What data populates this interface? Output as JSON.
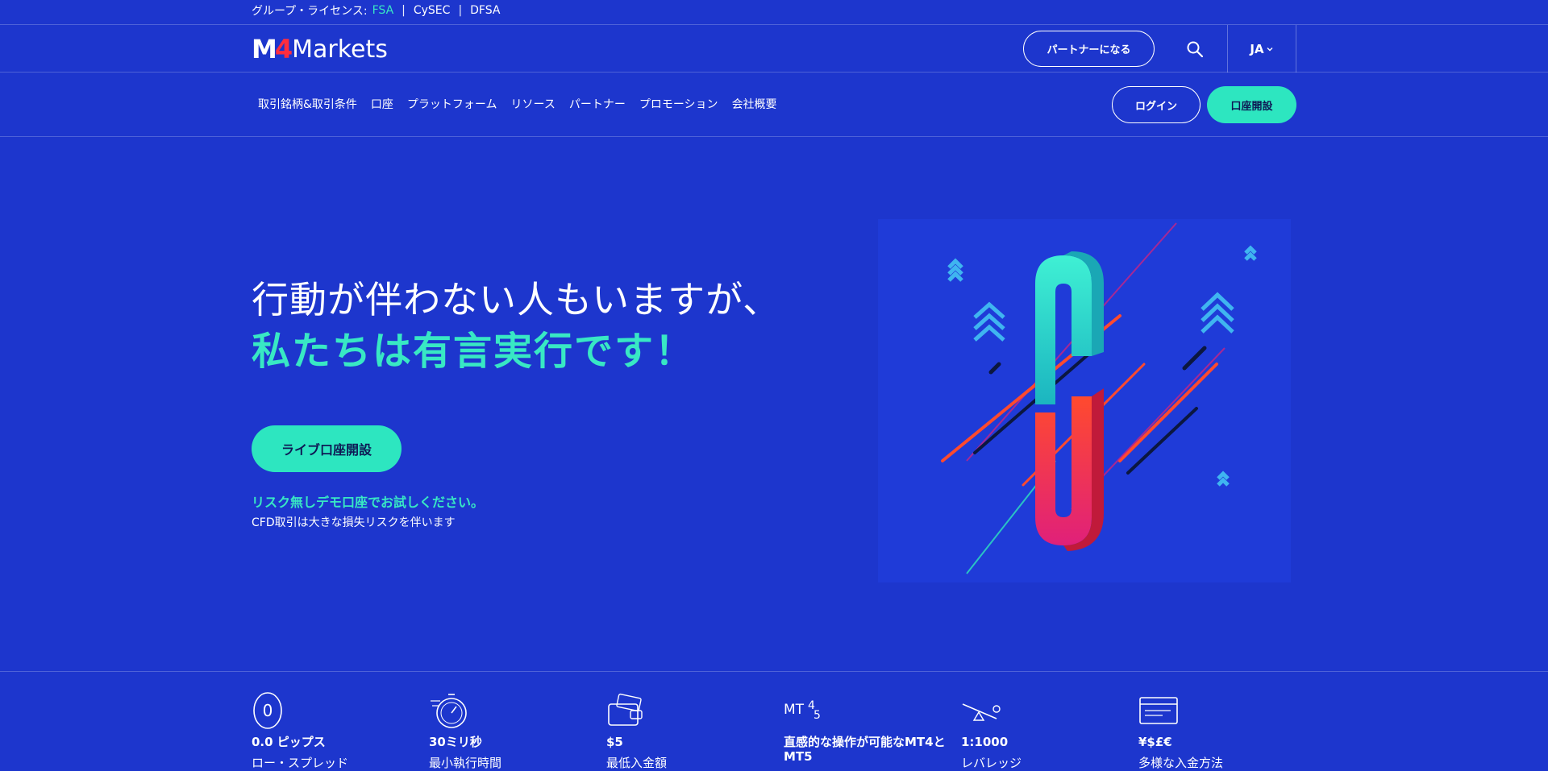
{
  "license_bar": {
    "prefix": "グループ・ライセンス:",
    "items": [
      "FSA",
      "CySEC",
      "DFSA"
    ],
    "separator": "|"
  },
  "header": {
    "logo_mark_m": "M",
    "logo_mark_4": "4",
    "logo_word": "Markets",
    "partner_button": "パートナーになる",
    "search_icon": "search-icon",
    "language": "JA"
  },
  "nav": {
    "items": [
      "取引銘柄&取引条件",
      "口座",
      "プラットフォーム",
      "リソース",
      "パートナー",
      "プロモーション",
      "会社概要"
    ],
    "login_button": "ログイン",
    "open_account_button": "口座開設"
  },
  "hero": {
    "title_line1": "行動が伴わない人もいますが、",
    "title_line2": "私たちは有言実行です！",
    "cta_button": "ライブ口座開設",
    "demo_link": "リスク無しデモ口座でお試しください。",
    "risk_note": "CFD取引は大きな損失リスクを伴います"
  },
  "features": [
    {
      "icon": "zero-icon",
      "value": "0.0 ピップス",
      "desc": "ロー・スプレッド"
    },
    {
      "icon": "stopwatch-icon",
      "value": "30ミリ秒",
      "desc": "最小執行時間"
    },
    {
      "icon": "wallet-icon",
      "value": "$5",
      "desc": "最低入金額"
    },
    {
      "icon": "mt45-icon",
      "value": "直感的な操作が可能なMT4とMT5",
      "desc": ""
    },
    {
      "icon": "seesaw-icon",
      "value": "1:1000",
      "desc": "レバレッジ"
    },
    {
      "icon": "card-icon",
      "value": "¥$£€",
      "desc": "多様な入金方法"
    }
  ],
  "colors": {
    "background": "#1d36cd",
    "accent": "#2de6c0",
    "logo_red": "#ff2d3f"
  }
}
